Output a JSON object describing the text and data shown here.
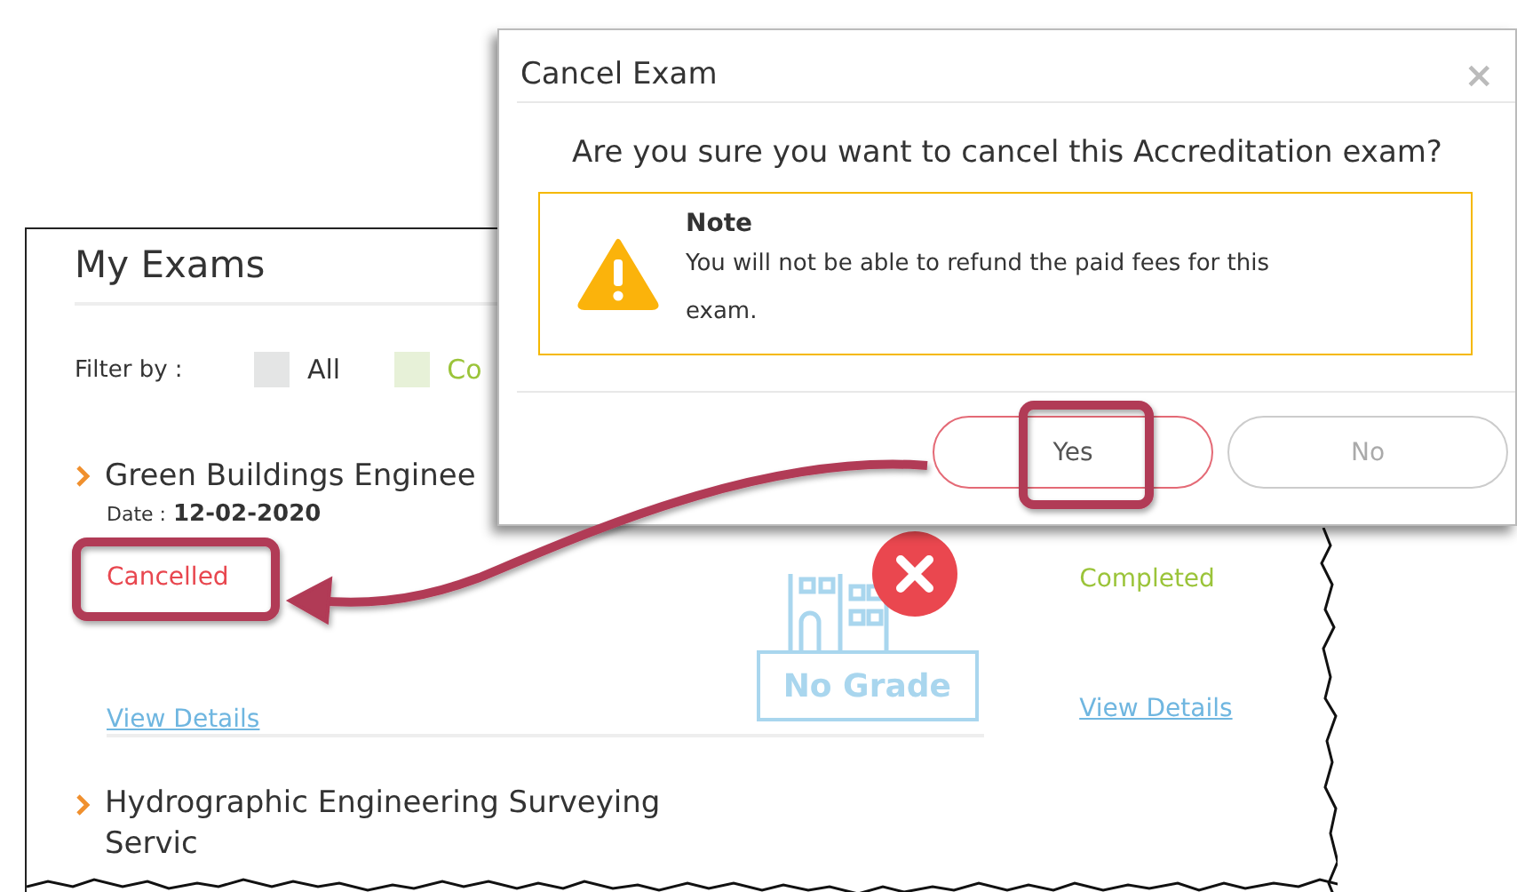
{
  "exam_list": {
    "title": "My Exams",
    "filter": {
      "label": "Filter by :",
      "options": [
        {
          "label": "All",
          "color": "#e4e5e5",
          "kind": "all"
        },
        {
          "label": "Co",
          "color": "#e7f1d8",
          "kind": "completed"
        }
      ]
    },
    "rows": [
      {
        "exams": [
          {
            "title": "Green Buildings Enginee",
            "date_label": "Date :",
            "date": "12-02-2020",
            "status": "Cancelled",
            "kind": "cancelled",
            "link": "View Details"
          },
          {
            "status": "Completed",
            "kind": "completed",
            "link": "View Details"
          }
        ],
        "grade_badge": "No Grade"
      },
      {
        "exams": [
          {
            "title": "Hydrographic Engineering Surveying Servic"
          }
        ]
      }
    ]
  },
  "dialog": {
    "title": "Cancel Exam",
    "close": "×",
    "question": "Are you sure you want to cancel this Accreditation exam?",
    "note": {
      "heading": "Note",
      "text": "You will not be able to refund the paid fees for this exam."
    },
    "buttons": [
      {
        "label": "Yes",
        "kind": "confirm"
      },
      {
        "label": "No",
        "kind": "cancel"
      }
    ]
  }
}
